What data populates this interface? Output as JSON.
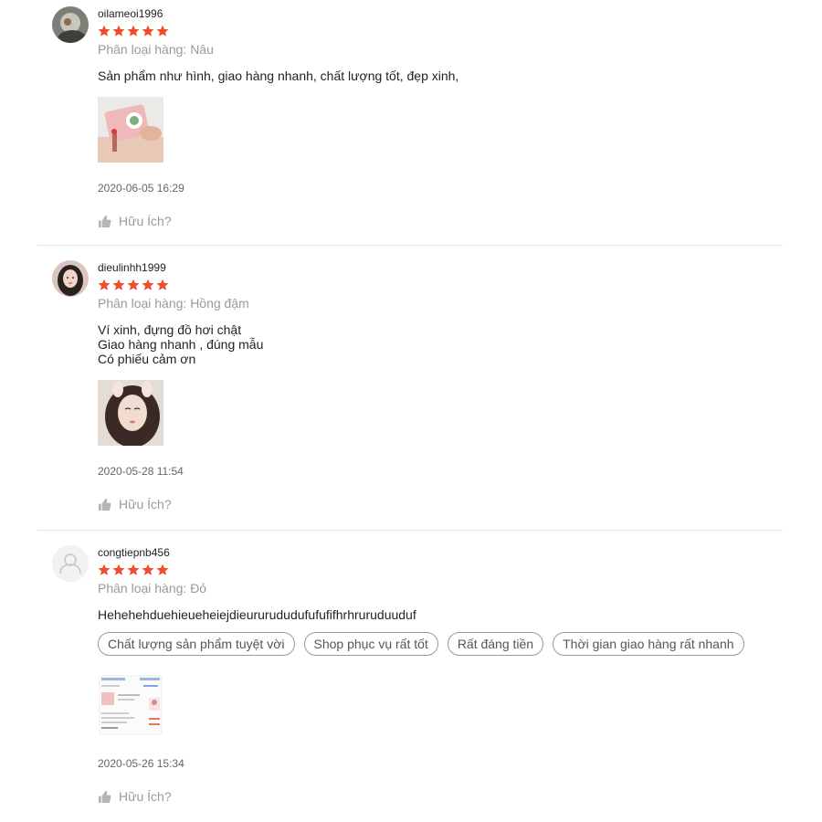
{
  "colors": {
    "star": "#ee4d2d",
    "muted": "#9a9a9a",
    "divider": "#e5e5e5"
  },
  "icons": {
    "star": "star-icon",
    "helpful": "thumbs-up-icon",
    "default_avatar": "user-icon"
  },
  "reviews": [
    {
      "username": "oilameoi1996",
      "rating": 5,
      "variation": "Phân loại hàng: Nâu",
      "content": "Sản phẩm như hình, giao hàng nhanh, chất lượng tốt, đẹp xinh,",
      "tags": [],
      "time": "2020-06-05 16:29",
      "helpful_label": "Hữu Ích?"
    },
    {
      "username": "dieulinhh1999",
      "rating": 5,
      "variation": "Phân loại hàng: Hồng đậm",
      "content": "Ví xinh, đựng đồ hơi chật\nGiao hàng nhanh , đúng mẫu\nCó phiếu cảm ơn",
      "tags": [],
      "time": "2020-05-28 11:54",
      "helpful_label": "Hữu Ích?"
    },
    {
      "username": "congtiepnb456",
      "rating": 5,
      "variation": "Phân loại hàng: Đỏ",
      "content": "Hehehehduehieueheiejdieururududufufufifhrhruruduuduf",
      "tags": [
        "Chất lượng sản phẩm tuyệt vời",
        "Shop phục vụ rất tốt",
        "Rất đáng tiền",
        "Thời gian giao hàng rất nhanh"
      ],
      "time": "2020-05-26 15:34",
      "helpful_label": "Hữu Ích?"
    }
  ]
}
